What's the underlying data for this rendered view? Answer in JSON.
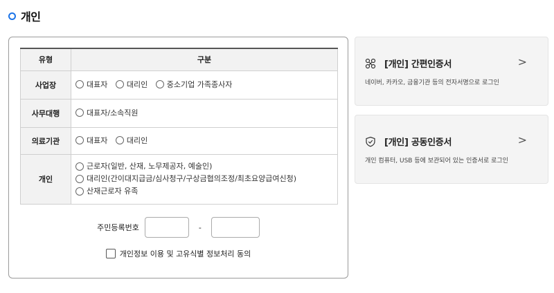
{
  "section": {
    "title": "개인"
  },
  "table": {
    "headers": {
      "type": "유형",
      "category": "구분"
    },
    "rows": [
      {
        "type": "사업장",
        "options": [
          "대표자",
          "대리인",
          "중소기업 가족종사자"
        ]
      },
      {
        "type": "사무대행",
        "options": [
          "대표자/소속직원"
        ]
      },
      {
        "type": "의료기관",
        "options": [
          "대표자",
          "대리인"
        ]
      },
      {
        "type": "개인",
        "options": [
          "근로자(일반, 산재, 노무제공자, 예술인)",
          "대리인(간이대지급금/심사청구/구상금협의조정/최초요양급여신청)",
          "산재근로자 유족"
        ]
      }
    ]
  },
  "rrn": {
    "label": "주민등록번호",
    "separator": "-",
    "first_value": "",
    "second_value": ""
  },
  "consent": {
    "label": "개인정보 이용 및 고유식별 정보처리 동의",
    "checked": false
  },
  "cards": [
    {
      "icon": "simple-cert-icon",
      "title": "[개인] 간편인증서",
      "desc": "네이버, 카카오, 금융기관 등의 전자서명으로 로그인",
      "arrow": ">"
    },
    {
      "icon": "shield-check-icon",
      "title": "[개인] 공동인증서",
      "desc": "개인 컴퓨터, USB 등에 보관되어 있는 인증서로 로그인",
      "arrow": ">"
    }
  ],
  "colors": {
    "accent": "#1a73e8",
    "card_bg": "#f4f4f4",
    "header_bg": "#f2f2f2"
  }
}
